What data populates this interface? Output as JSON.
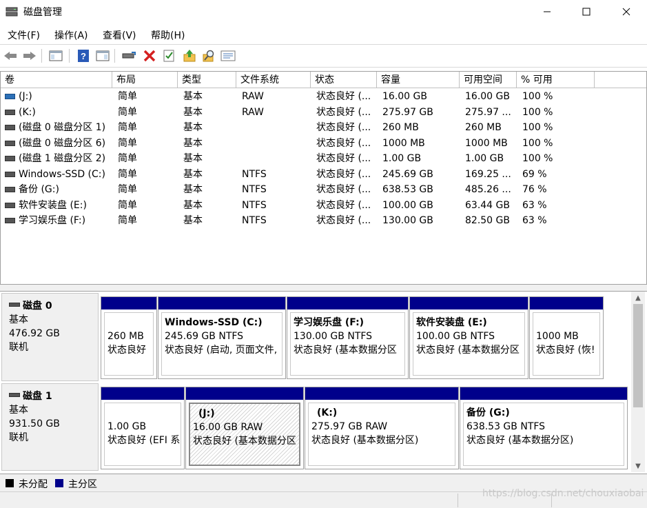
{
  "window": {
    "title": "磁盘管理"
  },
  "menu": [
    "文件(F)",
    "操作(A)",
    "查看(V)",
    "帮助(H)"
  ],
  "columns": [
    "卷",
    "布局",
    "类型",
    "文件系统",
    "状态",
    "容量",
    "可用空间",
    "% 可用"
  ],
  "volumes": [
    {
      "name": "(J:)",
      "layout": "简单",
      "type": "基本",
      "fs": "RAW",
      "status": "状态良好 (...",
      "capacity": "16.00 GB",
      "free": "16.00 GB",
      "pct": "100 %",
      "icon": "blue"
    },
    {
      "name": "(K:)",
      "layout": "简单",
      "type": "基本",
      "fs": "RAW",
      "status": "状态良好 (...",
      "capacity": "275.97 GB",
      "free": "275.97 ...",
      "pct": "100 %",
      "icon": "gray"
    },
    {
      "name": "(磁盘 0 磁盘分区 1)",
      "layout": "简单",
      "type": "基本",
      "fs": "",
      "status": "状态良好 (...",
      "capacity": "260 MB",
      "free": "260 MB",
      "pct": "100 %",
      "icon": "gray"
    },
    {
      "name": "(磁盘 0 磁盘分区 6)",
      "layout": "简单",
      "type": "基本",
      "fs": "",
      "status": "状态良好 (...",
      "capacity": "1000 MB",
      "free": "1000 MB",
      "pct": "100 %",
      "icon": "gray"
    },
    {
      "name": "(磁盘 1 磁盘分区 2)",
      "layout": "简单",
      "type": "基本",
      "fs": "",
      "status": "状态良好 (...",
      "capacity": "1.00 GB",
      "free": "1.00 GB",
      "pct": "100 %",
      "icon": "gray"
    },
    {
      "name": "Windows-SSD (C:)",
      "layout": "简单",
      "type": "基本",
      "fs": "NTFS",
      "status": "状态良好 (...",
      "capacity": "245.69 GB",
      "free": "169.25 ...",
      "pct": "69 %",
      "icon": "gray"
    },
    {
      "name": "备份 (G:)",
      "layout": "简单",
      "type": "基本",
      "fs": "NTFS",
      "status": "状态良好 (...",
      "capacity": "638.53 GB",
      "free": "485.26 ...",
      "pct": "76 %",
      "icon": "gray"
    },
    {
      "name": "软件安装盘 (E:)",
      "layout": "简单",
      "type": "基本",
      "fs": "NTFS",
      "status": "状态良好 (...",
      "capacity": "100.00 GB",
      "free": "63.44 GB",
      "pct": "63 %",
      "icon": "gray"
    },
    {
      "name": "学习娱乐盘 (F:)",
      "layout": "简单",
      "type": "基本",
      "fs": "NTFS",
      "status": "状态良好 (...",
      "capacity": "130.00 GB",
      "free": "82.50 GB",
      "pct": "63 %",
      "icon": "gray"
    }
  ],
  "disks": [
    {
      "name": "磁盘 0",
      "kind": "基本",
      "size": "476.92 GB",
      "state": "联机",
      "partitions": [
        {
          "name": "",
          "line1": "260 MB",
          "line2": "状态良好",
          "hatch": false
        },
        {
          "name": "Windows-SSD  (C:)",
          "line1": "245.69 GB NTFS",
          "line2": "状态良好 (启动, 页面文件,",
          "hatch": false
        },
        {
          "name": "学习娱乐盘  (F:)",
          "line1": "130.00 GB NTFS",
          "line2": "状态良好 (基本数据分区",
          "hatch": false
        },
        {
          "name": "软件安装盘  (E:)",
          "line1": "100.00 GB NTFS",
          "line2": "状态良好 (基本数据分区",
          "hatch": false
        },
        {
          "name": "",
          "line1": "1000 MB",
          "line2": "状态良好 (恢!",
          "hatch": false
        }
      ]
    },
    {
      "name": "磁盘 1",
      "kind": "基本",
      "size": "931.50 GB",
      "state": "联机",
      "partitions": [
        {
          "name": "",
          "line1": "1.00 GB",
          "line2": "状态良好 (EFI 系",
          "hatch": false
        },
        {
          "name": "(J:)",
          "line1": "16.00 GB RAW",
          "line2": "状态良好 (基本数据分区",
          "hatch": true
        },
        {
          "name": "(K:)",
          "line1": "275.97 GB RAW",
          "line2": "状态良好 (基本数据分区)",
          "hatch": false
        },
        {
          "name": "备份  (G:)",
          "line1": "638.53 GB NTFS",
          "line2": "状态良好 (基本数据分区)",
          "hatch": false
        }
      ]
    }
  ],
  "legend": [
    {
      "label": "未分配",
      "color": "#000000"
    },
    {
      "label": "主分区",
      "color": "#00008b"
    }
  ],
  "watermark": "https://blog.csdn.net/chouxiaobai"
}
